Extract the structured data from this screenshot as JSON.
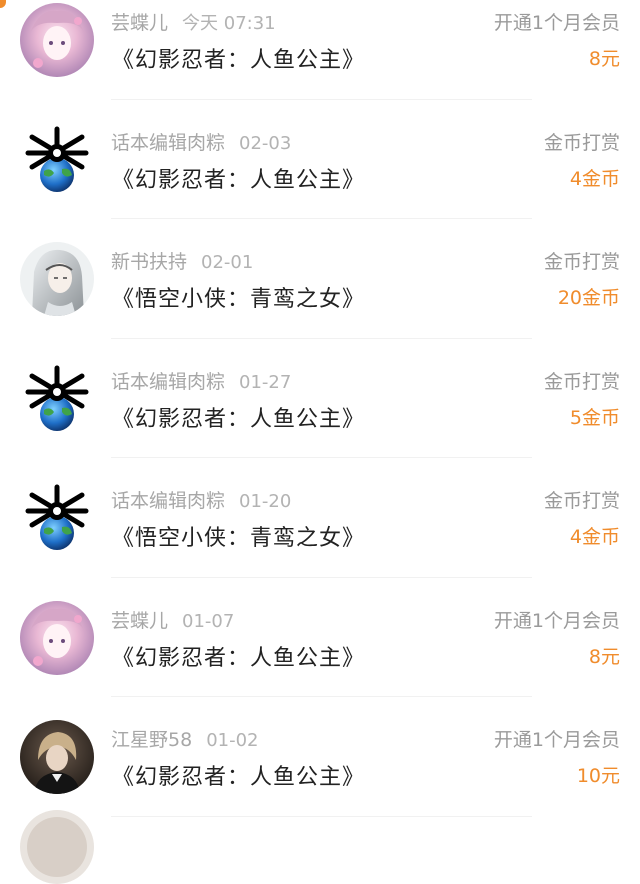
{
  "records": [
    {
      "avatar": "anime-girl-pink-avatar",
      "user": "芸蝶儿",
      "date": "今天 07:31",
      "title": "《幻影忍者：人鱼公主》",
      "type": "开通1个月会员",
      "amount": "8元"
    },
    {
      "avatar": "skull-bones-earth-avatar",
      "user": "话本编辑肉粽",
      "date": "02-03",
      "title": "《幻影忍者：人鱼公主》",
      "type": "金币打赏",
      "amount": "4金币"
    },
    {
      "avatar": "long-hair-man-avatar",
      "user": "新书扶持",
      "date": "02-01",
      "title": "《悟空小侠：青鸾之女》",
      "type": "金币打赏",
      "amount": "20金币"
    },
    {
      "avatar": "skull-bones-earth-avatar",
      "user": "话本编辑肉粽",
      "date": "01-27",
      "title": "《幻影忍者：人鱼公主》",
      "type": "金币打赏",
      "amount": "5金币"
    },
    {
      "avatar": "skull-bones-earth-avatar",
      "user": "话本编辑肉粽",
      "date": "01-20",
      "title": "《悟空小侠：青鸾之女》",
      "type": "金币打赏",
      "amount": "4金币"
    },
    {
      "avatar": "anime-girl-pink-avatar",
      "user": "芸蝶儿",
      "date": "01-07",
      "title": "《幻影忍者：人鱼公主》",
      "type": "开通1个月会员",
      "amount": "8元"
    },
    {
      "avatar": "dark-portrait-avatar",
      "user": "江星野58",
      "date": "01-02",
      "title": "《幻影忍者：人鱼公主》",
      "type": "开通1个月会员",
      "amount": "10元"
    }
  ],
  "colors": {
    "accent": "#f08c2c",
    "meta_text": "#a7a7a7",
    "title_text": "#222222",
    "divider": "#f1f1f1"
  }
}
